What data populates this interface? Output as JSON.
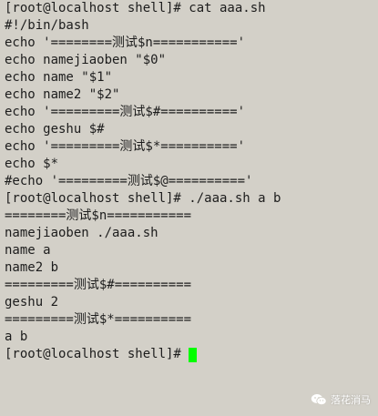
{
  "terminal": {
    "lines": [
      "[root@localhost shell]# cat aaa.sh",
      "#!/bin/bash",
      "echo '========测试$n==========='",
      "echo namejiaoben \"$0\"",
      "echo name \"$1\"",
      "echo name2 \"$2\"",
      "echo '=========测试$#=========='",
      "echo geshu $#",
      "echo '=========测试$*=========='",
      "echo $*",
      "#echo '=========测试$@=========='",
      "[root@localhost shell]# ./aaa.sh a b",
      "========测试$n===========",
      "namejiaoben ./aaa.sh",
      "name a",
      "name2 b",
      "=========测试$#==========",
      "geshu 2",
      "=========测试$*==========",
      "a b"
    ],
    "prompt": "[root@localhost shell]# ",
    "cursor_color": "#00ff00",
    "background_color": "#d3d0c8"
  },
  "watermark": {
    "icon": "wechat-icon",
    "text": "落花消马"
  }
}
